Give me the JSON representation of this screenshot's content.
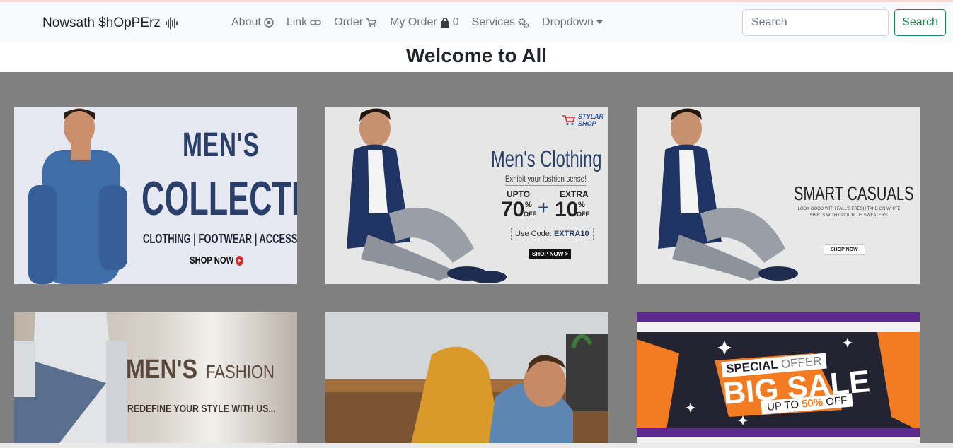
{
  "nav": {
    "brand": "Nowsath $hOpPErz",
    "links": [
      {
        "label": "About",
        "icon": "compass-icon"
      },
      {
        "label": "Link",
        "icon": "link-icon"
      },
      {
        "label": "Order",
        "icon": "cart-icon"
      },
      {
        "label": "My Order",
        "icon": "bag-icon",
        "count": "0"
      },
      {
        "label": "Services",
        "icon": "gears-icon"
      },
      {
        "label": "Dropdown",
        "icon": "caret-down-icon"
      }
    ],
    "search_placeholder": "Search",
    "search_button": "Search"
  },
  "welcome": "Welcome to All",
  "banners": [
    {
      "heading1": "MEN'S",
      "heading2": "COLLECTION",
      "sub": "CLOTHING | FOOTWEAR | ACCESSORIES",
      "cta": "SHOP NOW"
    },
    {
      "logo": "STYLAR SHOP",
      "title": "Men's Clothing",
      "sub": "Exhibit your fashion sense!",
      "upto_label": "UPTO",
      "upto_value": "70",
      "extra_label": "EXTRA",
      "extra_value": "10",
      "percent": "%",
      "off": "OFF",
      "plus": "+",
      "code_label": "Use Code:",
      "code": "EXTRA10",
      "cta": "SHOP NOW >"
    },
    {
      "title": "SMART CASUALS",
      "sub": "LOOK GOOD WITH FALL'S FRESH TAKE ON WHITE SHIRTS WITH COOL BLUE SWEATERS.",
      "cta": "SHOP NOW"
    },
    {
      "heading": "MEN'S",
      "heading_suffix": "FASHION",
      "sub": "REDEFINE YOUR STYLE WITH US..."
    },
    {},
    {
      "special": "SPECIAL",
      "offer": "OFFER",
      "big": "BIG SALE",
      "upto": "UP TO",
      "pct": "50%",
      "off": "OFF"
    }
  ],
  "colors": {
    "brand_green": "#198754",
    "banner_navy": "#2b3f6b",
    "sale_orange": "#f37b21"
  }
}
